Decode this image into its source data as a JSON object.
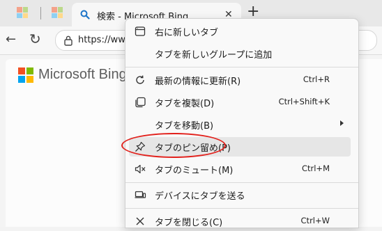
{
  "tab": {
    "title": "検索 - Microsoft Bing"
  },
  "address_bar": {
    "url": "https://www"
  },
  "page": {
    "logo_text": "Microsoft Bing"
  },
  "context_menu": {
    "items": [
      {
        "label": "右に新しいタブ",
        "shortcut": ""
      },
      {
        "label": "タブを新しいグループに追加",
        "shortcut": ""
      },
      {
        "label": "最新の情報に更新(R)",
        "shortcut": "Ctrl+R"
      },
      {
        "label": "タブを複製(D)",
        "shortcut": "Ctrl+Shift+K"
      },
      {
        "label": "タブを移動(B)",
        "shortcut": ""
      },
      {
        "label": "タブのピン留め(P)",
        "shortcut": ""
      },
      {
        "label": "タブのミュート(M)",
        "shortcut": "Ctrl+M"
      },
      {
        "label": "デバイスにタブを送る",
        "shortcut": ""
      },
      {
        "label": "タブを閉じる(C)",
        "shortcut": "Ctrl+W"
      }
    ]
  },
  "colors": {
    "highlight_oval": "#e2211c",
    "ms_red": "#f25022",
    "ms_green": "#7fba00",
    "ms_blue": "#00a4ef",
    "ms_yellow": "#ffb900"
  }
}
